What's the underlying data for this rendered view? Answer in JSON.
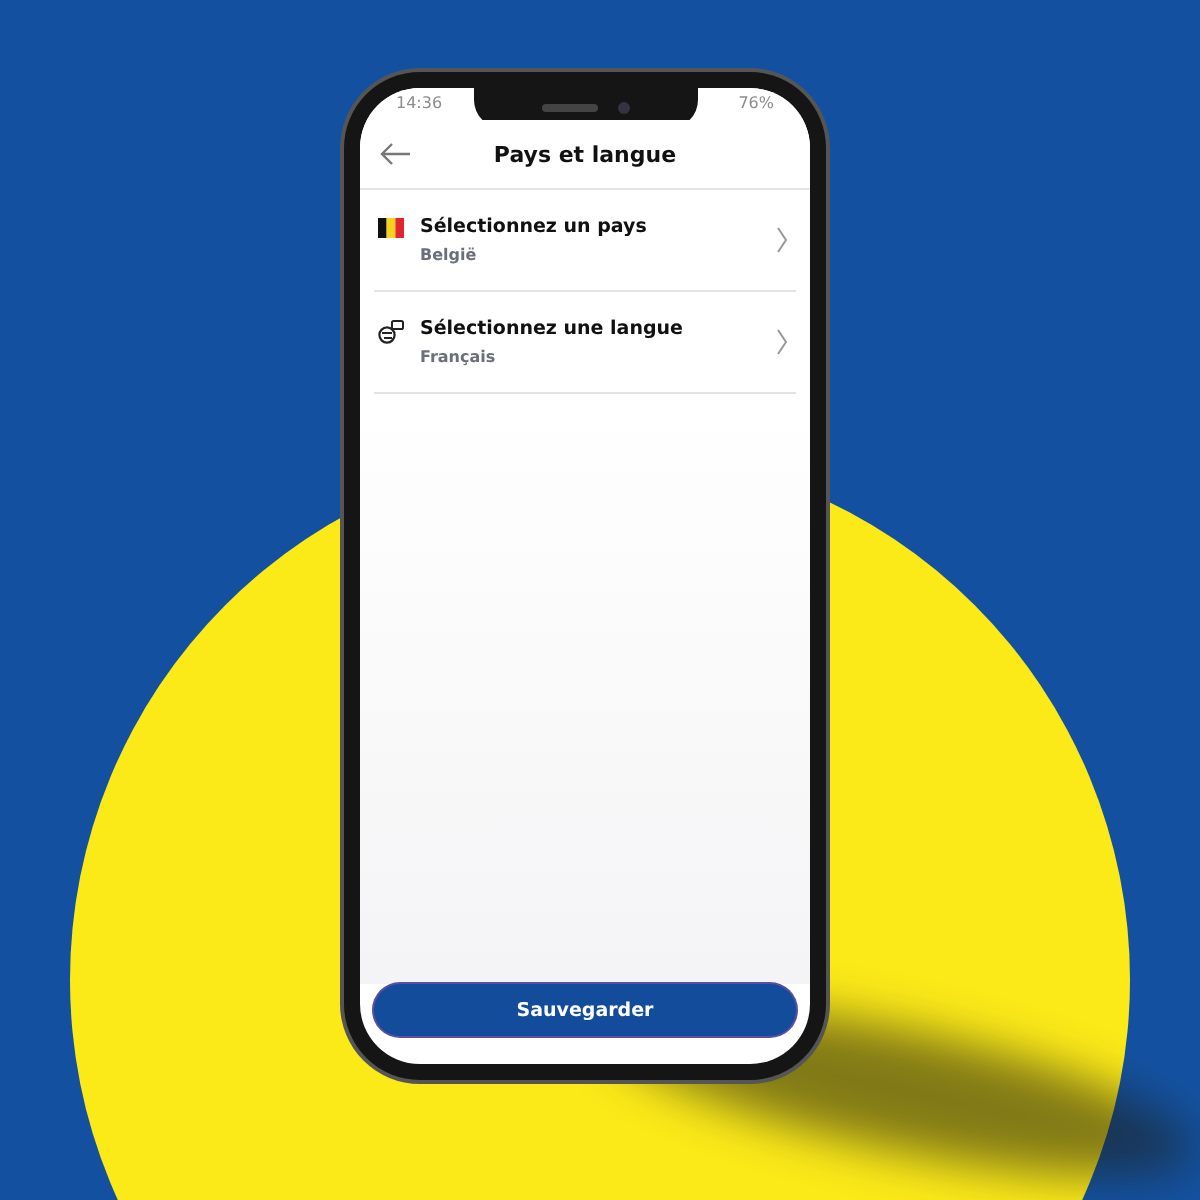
{
  "status_bar": {
    "time": "14:36",
    "battery": "76%"
  },
  "header": {
    "title": "Pays et langue"
  },
  "settings": [
    {
      "kind": "country",
      "label": "Sélectionnez un pays",
      "value": "België"
    },
    {
      "kind": "language",
      "label": "Sélectionnez une langue",
      "value": "Français"
    }
  ],
  "save_button": {
    "label": "Sauvegarder"
  }
}
